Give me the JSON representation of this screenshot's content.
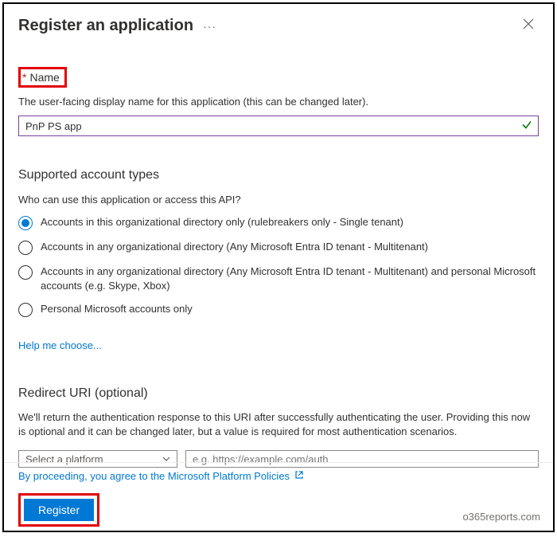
{
  "header": {
    "title": "Register an application",
    "ellipsis": "···"
  },
  "name": {
    "required_mark": "*",
    "label": "Name",
    "help": "The user-facing display name for this application (this can be changed later).",
    "value": "PnP PS app"
  },
  "account_types": {
    "heading": "Supported account types",
    "question": "Who can use this application or access this API?",
    "options": [
      "Accounts in this organizational directory only (rulebreakers only - Single tenant)",
      "Accounts in any organizational directory (Any Microsoft Entra ID tenant - Multitenant)",
      "Accounts in any organizational directory (Any Microsoft Entra ID tenant - Multitenant) and personal Microsoft accounts (e.g. Skype, Xbox)",
      "Personal Microsoft accounts only"
    ],
    "selected": 0,
    "help_link": "Help me choose..."
  },
  "redirect": {
    "heading": "Redirect URI (optional)",
    "help": "We'll return the authentication response to this URI after successfully authenticating the user. Providing this now is optional and it can be changed later, but a value is required for most authentication scenarios.",
    "platform_placeholder": "Select a platform",
    "uri_placeholder": "e.g. https://example.com/auth"
  },
  "footer": {
    "policy_text": "By proceeding, you agree to the Microsoft Platform Policies",
    "register_label": "Register"
  },
  "watermark": "o365reports.com"
}
